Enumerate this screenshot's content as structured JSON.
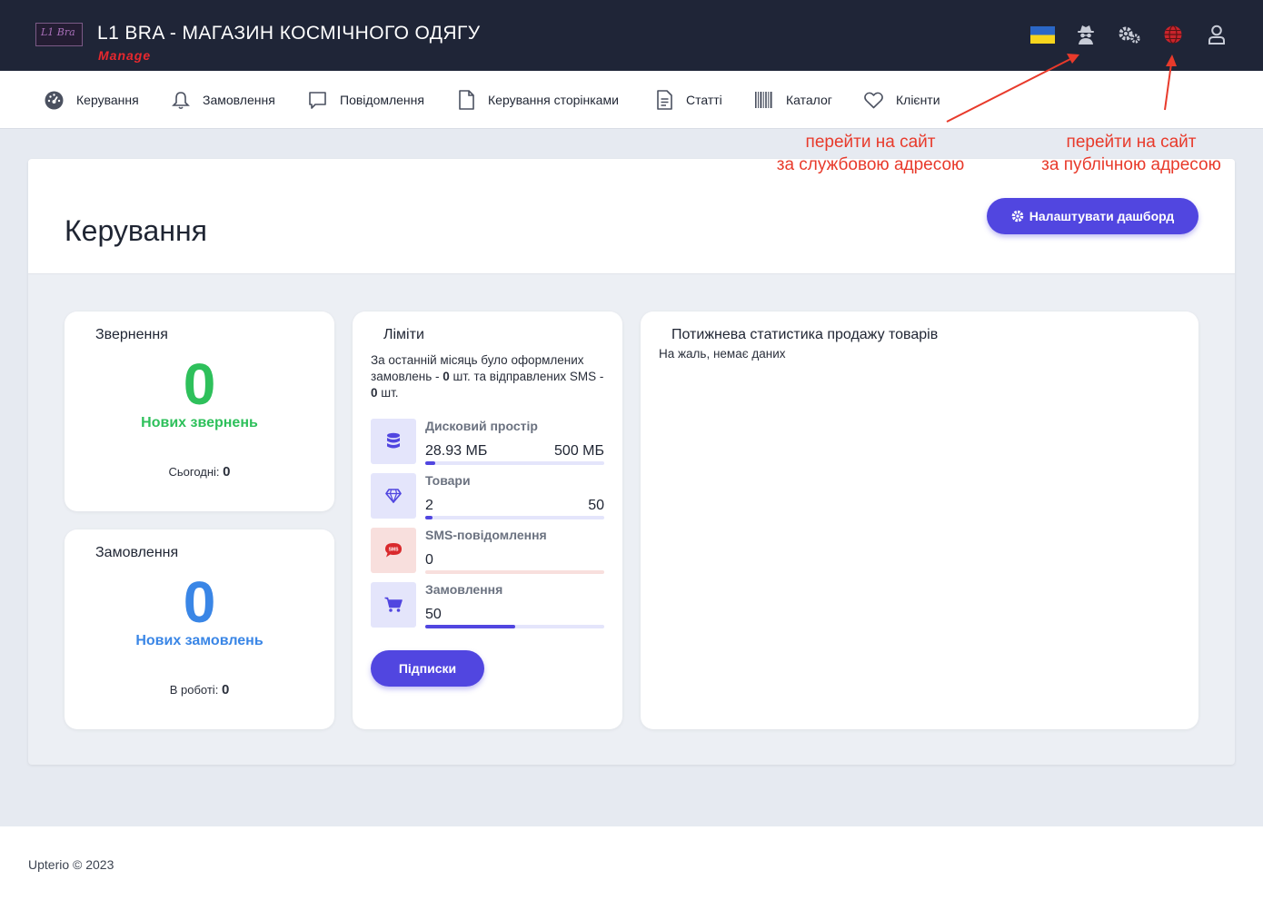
{
  "header": {
    "logo_text": "L1 Bra",
    "title": "L1 BRA - МАГАЗИН КОСМІЧНОГО ОДЯГУ",
    "subtitle": "Manage",
    "icons": [
      "ukraine-flag-icon",
      "spy-icon",
      "gears-icon",
      "globe-icon",
      "user-icon"
    ]
  },
  "nav": {
    "items": [
      {
        "label": "Керування",
        "icon": "dashboard-icon"
      },
      {
        "label": "Замовлення",
        "icon": "bell-icon"
      },
      {
        "label": "Повідомлення",
        "icon": "chat-icon"
      },
      {
        "label": "Керування сторінками",
        "icon": "page-icon"
      },
      {
        "label": "Статті",
        "icon": "article-icon"
      },
      {
        "label": "Каталог",
        "icon": "barcode-icon"
      },
      {
        "label": "Клієнти",
        "icon": "heart-icon"
      }
    ]
  },
  "annotations": {
    "service_line1": "перейти на сайт",
    "service_line2": "за службовою адресою",
    "public_line1": "перейти на сайт",
    "public_line2": "за публічною адресою",
    "color": "#e83a2b"
  },
  "main": {
    "title": "Керування",
    "configure_button": "Налаштувати дашборд"
  },
  "appeals": {
    "title": "Звернення",
    "count": "0",
    "label": "Нових звернень",
    "today_label": "Сьогодні:",
    "today_value": "0",
    "color": "#2ec05b"
  },
  "orders": {
    "title": "Замовлення",
    "count": "0",
    "label": "Нових замовлень",
    "in_work_label": "В роботі:",
    "in_work_value": "0",
    "color": "#3a86e6"
  },
  "limits": {
    "title": "Ліміти",
    "text_prefix": "За останній місяць було оформлених замовлень - ",
    "orders_count": "0",
    "text_middle": " шт. та відправлених SMS - ",
    "sms_count": "0",
    "text_suffix": " шт.",
    "rows": [
      {
        "name": "Дисковий простір",
        "value": "28.93 МБ",
        "max": "500 МБ",
        "fraction": 0.058,
        "icon": "database-icon"
      },
      {
        "name": "Товари",
        "value": "2",
        "max": "50",
        "fraction": 0.04,
        "icon": "diamond-icon"
      },
      {
        "name": "SMS-повідомлення",
        "value": "0",
        "max": "",
        "fraction": 0,
        "icon": "sms-icon"
      },
      {
        "name": "Замовлення",
        "value": "50",
        "max": "",
        "fraction": 0.5,
        "icon": "cart-icon"
      }
    ],
    "button": "Підписки"
  },
  "weekly": {
    "title": "Потижнева статистика продажу товарів",
    "empty": "На жаль, немає даних"
  },
  "footer": {
    "text": "Upterio © 2023"
  },
  "colors": {
    "accent": "#5146e0",
    "header_bg": "#1f2537",
    "globe": "#c9242b"
  }
}
